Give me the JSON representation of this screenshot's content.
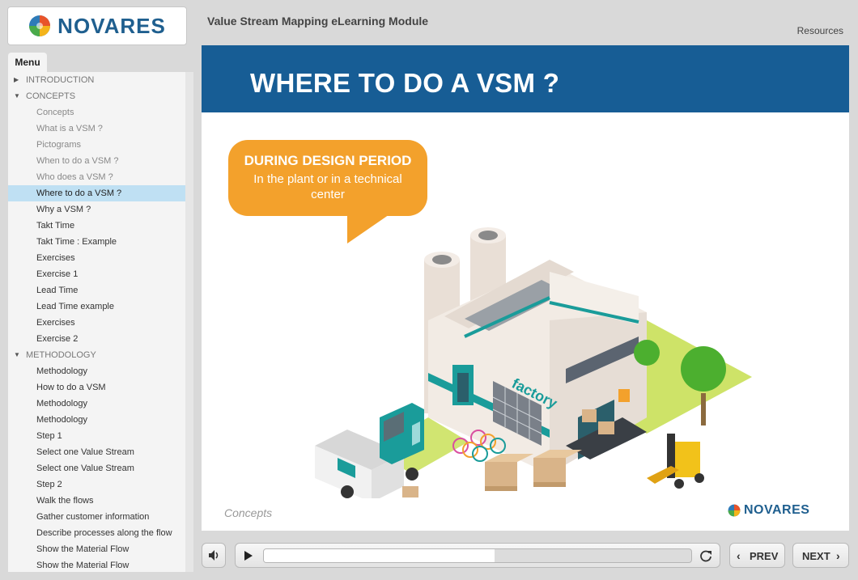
{
  "header": {
    "logo_text": "NOVARES",
    "course_title": "Value Stream Mapping eLearning Module",
    "resources_label": "Resources"
  },
  "menu": {
    "tab_label": "Menu",
    "items": [
      {
        "label": "INTRODUCTION",
        "kind": "section",
        "expanded": false
      },
      {
        "label": "CONCEPTS",
        "kind": "section",
        "expanded": true
      },
      {
        "label": "Concepts",
        "kind": "sub",
        "visited": true
      },
      {
        "label": "What is a VSM ?",
        "kind": "sub",
        "visited": true
      },
      {
        "label": "Pictograms",
        "kind": "sub",
        "visited": true
      },
      {
        "label": "When to do a VSM ?",
        "kind": "sub",
        "visited": true
      },
      {
        "label": "Who does a VSM ?",
        "kind": "sub",
        "visited": true
      },
      {
        "label": "Where to do a VSM ?",
        "kind": "sub",
        "selected": true
      },
      {
        "label": "Why a VSM ?",
        "kind": "sub"
      },
      {
        "label": "Takt Time",
        "kind": "sub"
      },
      {
        "label": "Takt Time : Example",
        "kind": "sub"
      },
      {
        "label": "Exercises",
        "kind": "sub"
      },
      {
        "label": "Exercise 1",
        "kind": "sub"
      },
      {
        "label": "Lead Time",
        "kind": "sub"
      },
      {
        "label": "Lead Time example",
        "kind": "sub"
      },
      {
        "label": "Exercises",
        "kind": "sub"
      },
      {
        "label": "Exercise 2",
        "kind": "sub"
      },
      {
        "label": "METHODOLOGY",
        "kind": "section",
        "expanded": true
      },
      {
        "label": "Methodology",
        "kind": "sub"
      },
      {
        "label": "How to do a VSM",
        "kind": "sub"
      },
      {
        "label": "Methodology",
        "kind": "sub"
      },
      {
        "label": "Methodology",
        "kind": "sub"
      },
      {
        "label": "Step 1",
        "kind": "sub"
      },
      {
        "label": "Select one Value Stream",
        "kind": "sub"
      },
      {
        "label": "Select one Value Stream",
        "kind": "sub"
      },
      {
        "label": "Step 2",
        "kind": "sub"
      },
      {
        "label": "Walk the flows",
        "kind": "sub"
      },
      {
        "label": "Gather customer information",
        "kind": "sub"
      },
      {
        "label": "Describe processes along the flow",
        "kind": "sub"
      },
      {
        "label": "Show the Material Flow",
        "kind": "sub"
      },
      {
        "label": "Show the Material Flow",
        "kind": "sub"
      }
    ]
  },
  "slide": {
    "title": "WHERE TO DO A VSM ?",
    "callout_heading": "DURING DESIGN PERIOD",
    "callout_text": "In the plant or in a technical center",
    "factory_sign": "factory",
    "footer_label": "Concepts",
    "footer_logo_text": "NOVARES"
  },
  "controls": {
    "progress_fraction": 0.54,
    "prev_label": "PREV",
    "next_label": "NEXT"
  },
  "colors": {
    "banner": "#175d95",
    "callout": "#f3a12c",
    "selected_menu": "#bfe0f3",
    "accent_teal": "#1a9c9a"
  },
  "icons": [
    "novares-logo-icon",
    "caret-right-icon",
    "caret-down-icon",
    "speaker-icon",
    "play-icon",
    "replay-icon",
    "chevron-left-icon",
    "chevron-right-icon"
  ]
}
